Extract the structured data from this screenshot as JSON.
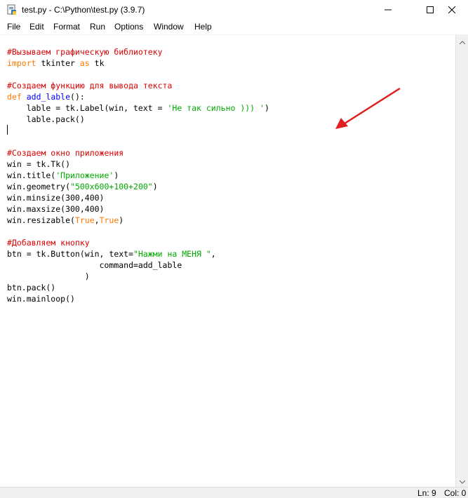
{
  "window": {
    "title": "test.py - C:\\Python\\test.py (3.9.7)"
  },
  "menu": {
    "items": [
      "File",
      "Edit",
      "Format",
      "Run",
      "Options",
      "Window",
      "Help"
    ]
  },
  "code": {
    "lines": [
      [
        {
          "t": "#Вызываем графическую библиотеку",
          "c": "cmt"
        }
      ],
      [
        {
          "t": "import",
          "c": "kw"
        },
        {
          "t": " tkinter ",
          "c": ""
        },
        {
          "t": "as",
          "c": "kw"
        },
        {
          "t": " tk",
          "c": ""
        }
      ],
      [],
      [
        {
          "t": "#Создаем функцию для вывода текста",
          "c": "cmt"
        }
      ],
      [
        {
          "t": "def",
          "c": "kw"
        },
        {
          "t": " ",
          "c": ""
        },
        {
          "t": "add_lable",
          "c": "def"
        },
        {
          "t": "():",
          "c": ""
        }
      ],
      [
        {
          "t": "    lable = tk.Label(win, text = ",
          "c": ""
        },
        {
          "t": "'Не так сильно ))) '",
          "c": "str"
        },
        {
          "t": ")",
          "c": ""
        }
      ],
      [
        {
          "t": "    lable.pack()",
          "c": ""
        }
      ],
      [
        {
          "t": "",
          "c": "caret"
        }
      ],
      [],
      [
        {
          "t": "#Создаем окно приложения",
          "c": "cmt"
        }
      ],
      [
        {
          "t": "win = tk.Tk()",
          "c": ""
        }
      ],
      [
        {
          "t": "win.title(",
          "c": ""
        },
        {
          "t": "'Приложение'",
          "c": "str"
        },
        {
          "t": ")",
          "c": ""
        }
      ],
      [
        {
          "t": "win.geometry(",
          "c": ""
        },
        {
          "t": "\"500x600+100+200\"",
          "c": "str"
        },
        {
          "t": ")",
          "c": ""
        }
      ],
      [
        {
          "t": "win.minsize(300,400)",
          "c": ""
        }
      ],
      [
        {
          "t": "win.maxsize(300,400)",
          "c": ""
        }
      ],
      [
        {
          "t": "win.resizable(",
          "c": ""
        },
        {
          "t": "True",
          "c": "kw"
        },
        {
          "t": ",",
          "c": ""
        },
        {
          "t": "True",
          "c": "kw"
        },
        {
          "t": ")",
          "c": ""
        }
      ],
      [],
      [
        {
          "t": "#Добавляем кнопку",
          "c": "cmt"
        }
      ],
      [
        {
          "t": "btn = tk.Button(win, text=",
          "c": ""
        },
        {
          "t": "\"Нажми на МЕНЯ \"",
          "c": "str"
        },
        {
          "t": ",",
          "c": ""
        }
      ],
      [
        {
          "t": "                   command=add_lable",
          "c": ""
        }
      ],
      [
        {
          "t": "                )",
          "c": ""
        }
      ],
      [
        {
          "t": "btn.pack()",
          "c": ""
        }
      ],
      [
        {
          "t": "win.mainloop()",
          "c": ""
        }
      ]
    ]
  },
  "status": {
    "line": "Ln: 9",
    "col": "Col: 0"
  },
  "colors": {
    "comment": "#dd0000",
    "keyword": "#ff7700",
    "definition": "#0000ff",
    "string": "#00aa00",
    "annotation_arrow": "#e02020"
  },
  "icons": {
    "app": "python-file-icon",
    "minimize": "minimize-icon",
    "maximize": "maximize-icon",
    "close": "close-icon"
  }
}
